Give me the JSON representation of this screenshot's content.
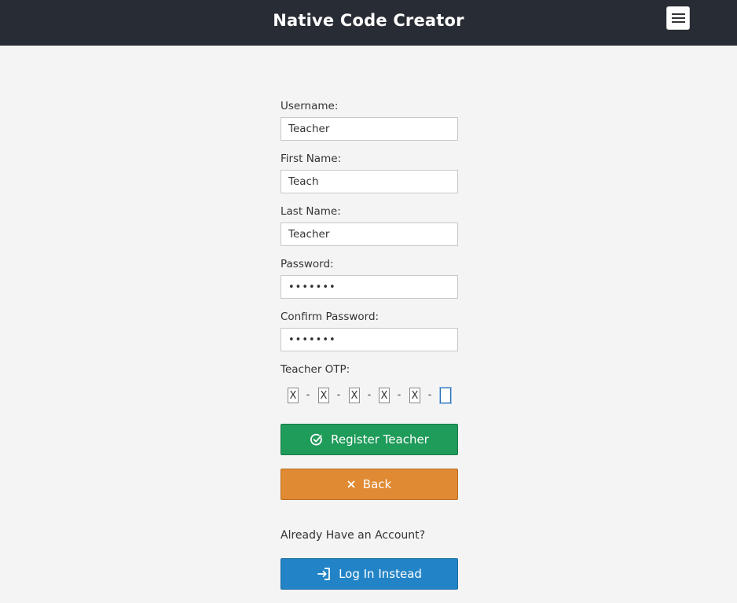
{
  "header": {
    "title": "Native Code Creator",
    "menu_icon": "hamburger-menu-icon"
  },
  "form": {
    "username": {
      "label": "Username:",
      "value": "Teacher"
    },
    "first_name": {
      "label": "First Name:",
      "value": "Teach"
    },
    "last_name": {
      "label": "Last Name:",
      "value": "Teacher"
    },
    "password": {
      "label": "Password:",
      "value": "•••••••"
    },
    "confirm_password": {
      "label": "Confirm Password:",
      "value": "•••••••"
    },
    "otp": {
      "label": "Teacher OTP:",
      "digits": [
        "X",
        "X",
        "X",
        "X",
        "X",
        ""
      ],
      "separator": "-"
    }
  },
  "actions": {
    "register_label": "Register Teacher",
    "register_icon": "check-circle-icon",
    "back_label": "Back",
    "back_icon": "close-icon",
    "already_text": "Already Have an Account?",
    "login_label": "Log In Instead",
    "login_icon": "login-icon"
  },
  "colors": {
    "header_bg": "#282c34",
    "page_bg": "#f4f4f4",
    "register": "#1f9b5a",
    "back": "#e08a33",
    "login": "#2284c7"
  }
}
